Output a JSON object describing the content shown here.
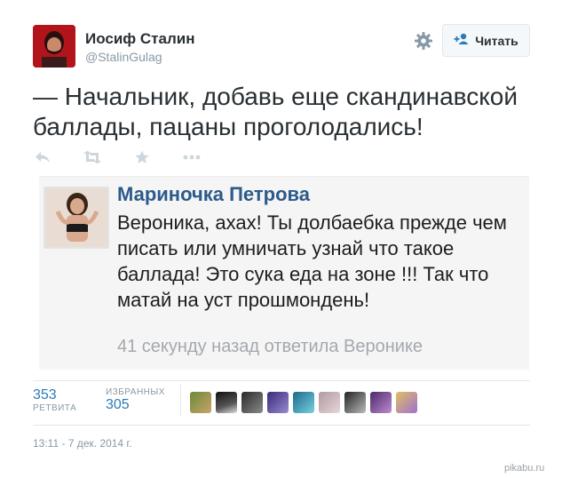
{
  "author": {
    "name": "Иосиф Сталин",
    "handle": "@StalinGulag"
  },
  "follow_button": {
    "label": "Читать"
  },
  "tweet": {
    "text": "— Начальник, добавь еще скандинавской баллады, пацаны проголодались!"
  },
  "actions": [
    "reply-icon",
    "retweet-icon",
    "favorite-icon",
    "more-icon"
  ],
  "embedded_reply": {
    "name": "Мариночка Петрова",
    "text": "Вероника, ахах! Ты долбаебка прежде чем писать или умничать узнай что такое баллада! Это сука еда на зоне !!!  Так что матай на уст прошмондень!",
    "time": "41 секунду назад ответила Веронике"
  },
  "stats": {
    "retweets": {
      "value": "353",
      "label": "РЕТВИТА"
    },
    "favorites": {
      "value": "305",
      "label": "ИЗБРАННЫХ"
    }
  },
  "favoriters_count_shown": 9,
  "timestamp": "13:11 - 7 дек. 2014 г.",
  "watermark": "pikabu.ru",
  "colors": {
    "link_blue": "#2b7bb9",
    "muted_gray": "#8899a6",
    "text_dark": "#292f33",
    "embed_name_blue": "#2c5a8a"
  }
}
